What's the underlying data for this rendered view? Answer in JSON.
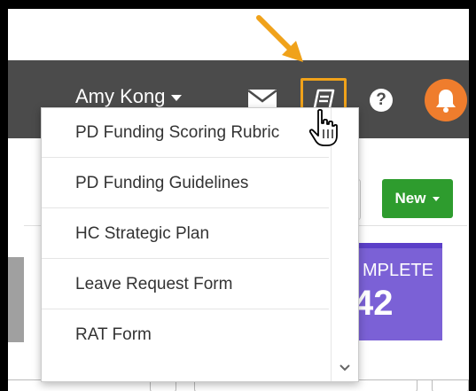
{
  "header": {
    "user_name": "Amy Kong",
    "help_symbol": "?",
    "icons": [
      "envelope-icon",
      "book-icon",
      "question-icon",
      "bell-icon",
      "caret-down-icon",
      "arrow-annotation-icon",
      "pointer-cursor-icon"
    ]
  },
  "toolbar": {
    "new_label": "New"
  },
  "stat_tile": {
    "label": "MPLETE",
    "value": "42",
    "color": "#7b61d6"
  },
  "dropdown": {
    "items": [
      {
        "label": "PD Funding Scoring Rubric"
      },
      {
        "label": "PD Funding Guidelines"
      },
      {
        "label": "HC Strategic Plan"
      },
      {
        "label": "Leave Request Form"
      },
      {
        "label": "RAT Form"
      }
    ]
  },
  "colors": {
    "topbar": "#4b4b4b",
    "highlight": "#f0a21a",
    "notification": "#ef7d2d",
    "new_button": "#2e9c2e"
  }
}
